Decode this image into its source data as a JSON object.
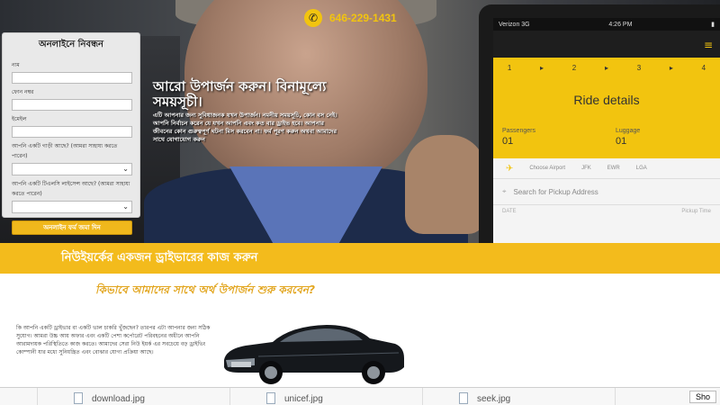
{
  "header": {
    "phone": "646-229-1431"
  },
  "form": {
    "title": "অনলাইনে নিবন্ধন",
    "fields": [
      "নাম",
      "ফোন নম্বর",
      "ইমেইল"
    ],
    "car_question": "আপনি একটি গাড়ী আছে? (আমরা সাহায্য করতে পারেন)",
    "license_question": "আপনি একটি টিএলসি লাইসেন্স আছে? (আমরা সাহায্য করতে পারেন)",
    "submit": "অনলাইন ফর্ম জমা দিন"
  },
  "hero": {
    "headline": "আরো উপার্জন করুন। বিনামূল্যে সময়সূচী।",
    "description": "এটি আপনার জন্য সুবিধাজনক যখন উপার্জন। নমনীয় সময়সূচি, কোন বস নেই। আপনি নির্বাচন করেন যে যখন আপনি এবং কত বার ড্রাইভ হবে। আপনার জীবনের কোন গুরুত্বপূর্ণ ঘটনা মিস করবেন না। ফর্ম পূরণ করুন অথবা আমাদের সাথে যোগাযোগ করুন"
  },
  "device": {
    "carrier": "Verizon 3G",
    "time": "4:26 PM",
    "steps": [
      "1",
      "2",
      "3",
      "4"
    ],
    "ride_title": "Ride details",
    "passengers_label": "Passengers",
    "passengers_value": "01",
    "luggage_label": "Luggage",
    "luggage_value": "01",
    "airports": [
      "Choose Airport",
      "JFK",
      "EWR",
      "LGA"
    ],
    "pickup_placeholder": "Search for Pickup Address",
    "pickup_date_label": "DATE",
    "pickup_time_label": "Pickup Time"
  },
  "banner": {
    "text": "নিউইয়র্কের একজন ড্রাইভারের কাজ করুন"
  },
  "section": {
    "title": "কিভাবে আমাদের সাথে অর্থ উপার্জন শুরু করবেন?",
    "body": "কি আপনি একটি ড্রাইভার বা একটি ভাল চাকরি খুঁজছেন? তারপর এটা আপনার জন্য সঠিক সুযোগ। আমরা উচ্চ আয় অফার এবং একটি পেশা কর্পোরেট পরিবহনের অধীনে আপনি আরামদায়ক পরিস্থিতিতে কাজ করতে। আমাদের সেরা নিউ ইয়র্ক এর সবচেয়ে বড় ড্রাইভিং কোম্পানী যার মধ্যে সুনিয়ন্ত্রিত এবং বোঝার যোগ্য প্রক্রিয়া আছে।"
  },
  "downloads": {
    "items": [
      "download.jpg",
      "unicef.jpg",
      "seek.jpg"
    ],
    "show_all": "Sho"
  }
}
